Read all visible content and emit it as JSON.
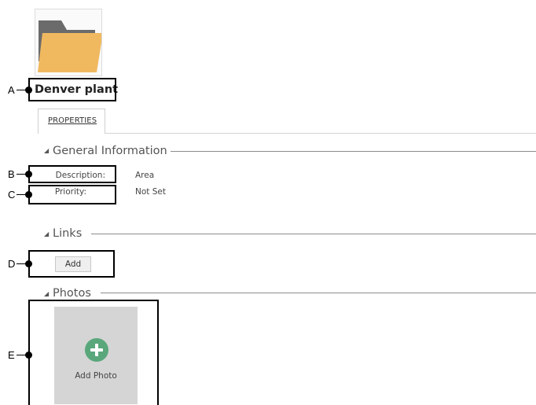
{
  "item": {
    "name": "Denver plant",
    "icon": "folder-icon"
  },
  "tabs": [
    {
      "label": "PROPERTIES",
      "selected": true
    }
  ],
  "general_information": {
    "heading": "General Information",
    "fields": [
      {
        "label": "Description:",
        "value": "Area"
      },
      {
        "label": "Priority:",
        "value": "Not Set"
      }
    ]
  },
  "links": {
    "heading": "Links",
    "add_label": "Add"
  },
  "photos": {
    "heading": "Photos",
    "add_photo_label": "Add Photo",
    "icon": "add-circle-icon"
  },
  "callouts": [
    "A",
    "B",
    "C",
    "D",
    "E"
  ],
  "colors": {
    "folder_back": "#6b6b6b",
    "folder_front": "#f0b960",
    "add_icon": "#5aa77c",
    "photo_tile": "#d5d5d5"
  }
}
